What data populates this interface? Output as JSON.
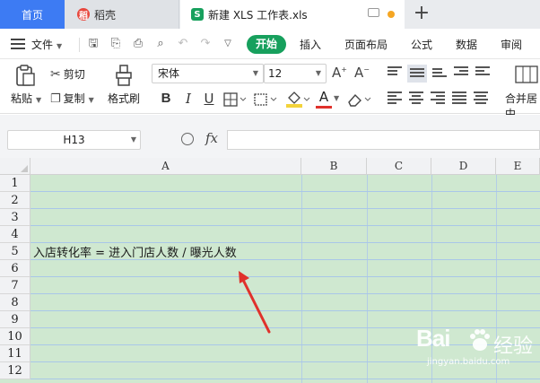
{
  "tabs": {
    "home": "首页",
    "daoke": "稻壳",
    "file": "新建 XLS 工作表.xls",
    "badge_daoke": "稻",
    "badge_file": "S"
  },
  "menu": {
    "file": "文件",
    "items": [
      "开始",
      "插入",
      "页面布局",
      "公式",
      "数据",
      "审阅"
    ]
  },
  "ribbon": {
    "paste": "粘贴",
    "cut": "剪切",
    "copy": "复制",
    "format_painter": "格式刷",
    "font_name": "宋体",
    "font_size": "12",
    "merge_center": "合并居中"
  },
  "formula_bar": {
    "name_box": "H13",
    "fx": "fx",
    "formula": ""
  },
  "sheet": {
    "columns": [
      "A",
      "B",
      "C",
      "D",
      "E"
    ],
    "rows": [
      "1",
      "2",
      "3",
      "4",
      "5",
      "6",
      "7",
      "8",
      "9",
      "10",
      "11",
      "12"
    ],
    "cell_A5": "入店转化率 = 进入门店人数 / 曝光人数"
  },
  "watermark": {
    "logo": "Bai",
    "text": "经验",
    "url": "jingyan.baidu.com"
  },
  "colors": {
    "grid_background": "#cfe8d0",
    "accent_green": "#17a05d",
    "home_tab_blue": "#3d7bf3",
    "arrow_red": "#e0312b"
  }
}
